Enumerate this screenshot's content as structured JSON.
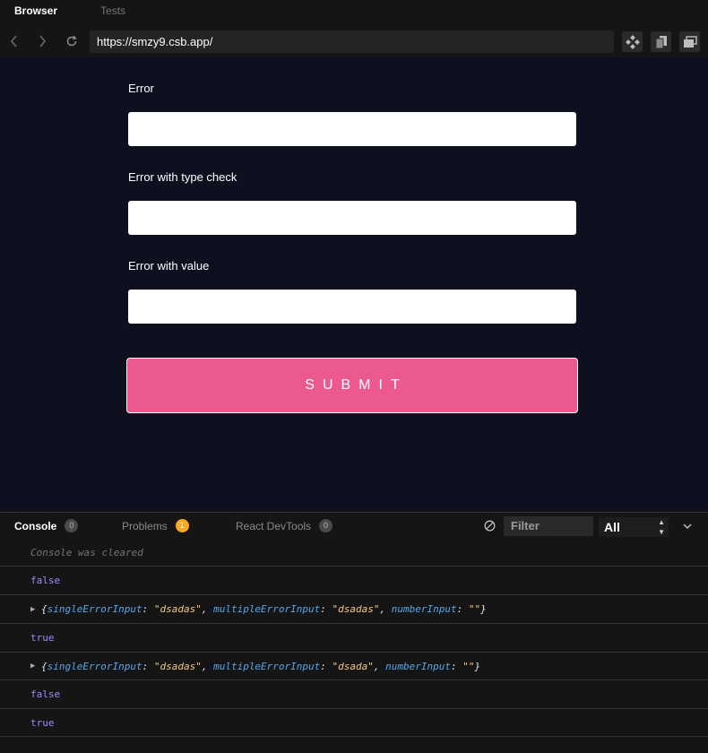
{
  "tabs": {
    "browser": "Browser",
    "tests": "Tests"
  },
  "address_bar": {
    "url": "https://smzy9.csb.app/",
    "back_icon": "chevron-left-icon",
    "forward_icon": "chevron-right-icon",
    "reload_icon": "reload-icon"
  },
  "form": {
    "fields": [
      {
        "label": "Error",
        "value": ""
      },
      {
        "label": "Error with type check",
        "value": ""
      },
      {
        "label": "Error with value",
        "value": ""
      }
    ],
    "submit_label": "SUBMIT"
  },
  "console_panel": {
    "tabs": [
      {
        "label": "Console",
        "count": "0"
      },
      {
        "label": "Problems",
        "count": "1"
      },
      {
        "label": "React DevTools",
        "count": "0"
      }
    ],
    "filter_placeholder": "Filter",
    "level": "All",
    "logs": {
      "cleared": "Console was cleared",
      "l1": "false",
      "obj1": {
        "k1": "singleErrorInput",
        "v1": "\"dsadas\"",
        "k2": "multipleErrorInput",
        "v2": "\"dsadas\"",
        "k3": "numberInput",
        "v3": "\"\""
      },
      "l2": "true",
      "obj2": {
        "k1": "singleErrorInput",
        "v1": "\"dsadas\"",
        "k2": "multipleErrorInput",
        "v2": "\"dsada\"",
        "k3": "numberInput",
        "v3": "\"\""
      },
      "l3": "false",
      "l4": "true"
    }
  },
  "colors": {
    "accent": "#ec5990",
    "preview_bg": "#0e1020",
    "badge_warning": "#f7a824"
  }
}
